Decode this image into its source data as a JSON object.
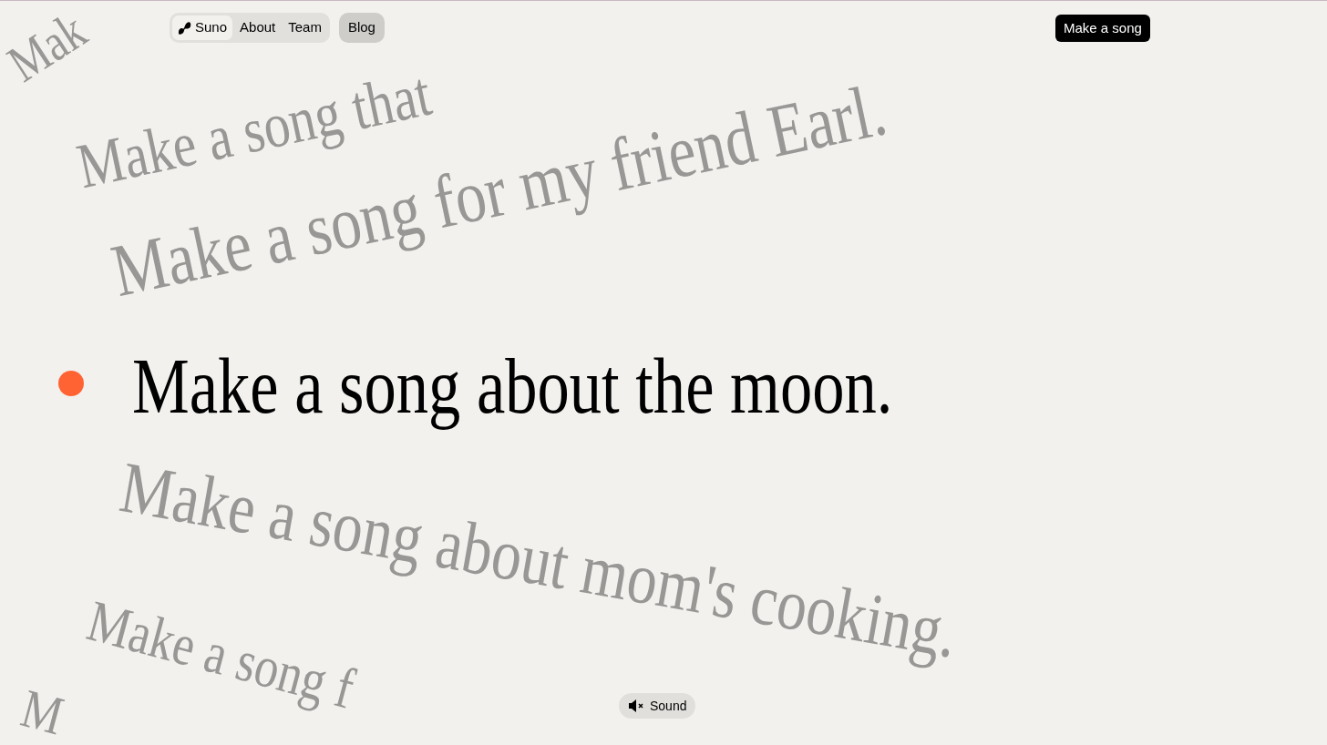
{
  "nav": {
    "items": [
      {
        "label": "Suno",
        "selected": true
      },
      {
        "label": "About",
        "selected": false
      },
      {
        "label": "Team",
        "selected": false
      }
    ],
    "blog": "Blog",
    "cta": "Make a song"
  },
  "prompts": [
    {
      "text": "Mak",
      "selected": false
    },
    {
      "text": "Make a song that",
      "selected": false
    },
    {
      "text": "Make a song for my friend Earl.",
      "selected": false
    },
    {
      "text": "Make a song about the moon.",
      "selected": true
    },
    {
      "text": "Make a song about mom's cooking.",
      "selected": false
    },
    {
      "text": "Make a song f",
      "selected": false
    },
    {
      "text": "M",
      "selected": false
    }
  ],
  "sound_button": {
    "label": "Sound",
    "muted": true
  }
}
